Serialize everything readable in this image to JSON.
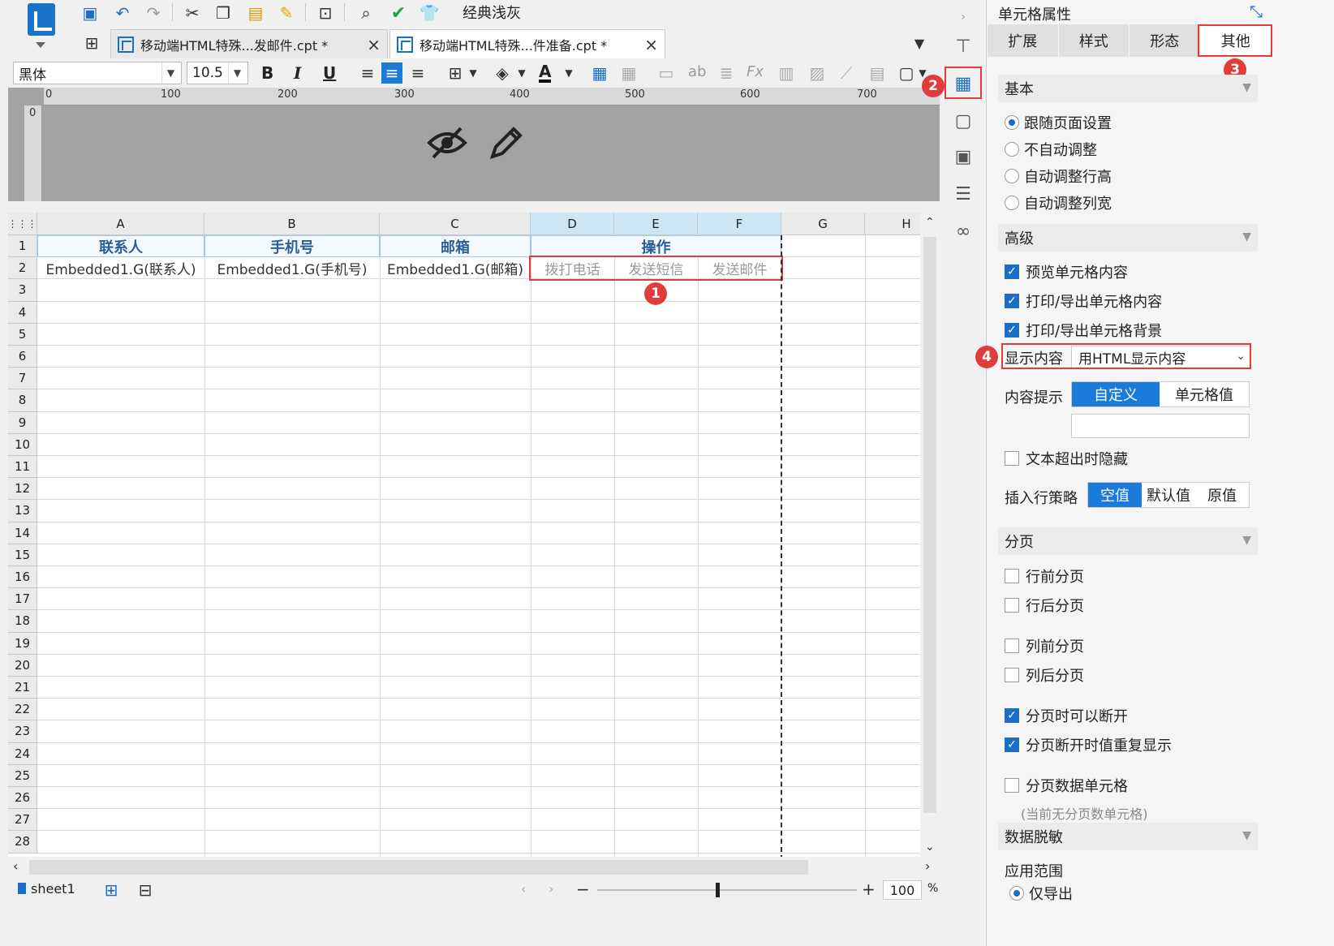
{
  "toolbar": {
    "theme_label": "经典浅灰"
  },
  "tabs": [
    {
      "label": "移动端HTML特殊...发邮件.cpt *",
      "close": "×"
    },
    {
      "label": "移动端HTML特殊...件准备.cpt *",
      "close": "×"
    }
  ],
  "format_bar": {
    "font_family": "黑体",
    "font_size": "10.5",
    "bold": "B",
    "italic": "I",
    "underline": "U",
    "font_color_label": "A"
  },
  "ruler": {
    "marks": [
      "0",
      "100",
      "200",
      "300",
      "400",
      "500",
      "600",
      "700"
    ],
    "v_zero": "0"
  },
  "sheet": {
    "columns": [
      "A",
      "B",
      "C",
      "D",
      "E",
      "F",
      "G",
      "H"
    ],
    "rows": [
      "1",
      "2",
      "3",
      "4",
      "5",
      "6",
      "7",
      "8",
      "9",
      "10",
      "11",
      "12",
      "13",
      "14",
      "15",
      "16",
      "17",
      "18",
      "19",
      "20",
      "21",
      "22",
      "23",
      "24",
      "25",
      "26",
      "27",
      "28"
    ],
    "header_row": {
      "a": "联系人",
      "b": "手机号",
      "c": "邮箱",
      "def": "操作"
    },
    "data_row": {
      "a": "Embedded1.G(联系人)",
      "b": "Embedded1.G(手机号)",
      "c": "Embedded1.G(邮箱)",
      "d": "拨打电话",
      "e": "发送短信",
      "f": "发送邮件"
    }
  },
  "badges": [
    "1",
    "2",
    "3",
    "4"
  ],
  "status": {
    "sheet_name": "sheet1",
    "zoom": "100",
    "zoom_unit": "%",
    "minus": "−",
    "plus": "+"
  },
  "panel": {
    "title": "单元格属性",
    "tabs": [
      "扩展",
      "样式",
      "形态",
      "其他"
    ],
    "basic": {
      "title": "基本",
      "options": [
        "跟随页面设置",
        "不自动调整",
        "自动调整行高",
        "自动调整列宽"
      ]
    },
    "advanced": {
      "title": "高级",
      "checks": [
        "预览单元格内容",
        "打印/导出单元格内容",
        "打印/导出单元格背景"
      ],
      "display_label": "显示内容",
      "display_value": "用HTML显示内容",
      "tip_label": "内容提示",
      "tip_options": [
        "自定义",
        "单元格值"
      ],
      "text_hide": "文本超出时隐藏",
      "insert_label": "插入行策略",
      "insert_options": [
        "空值",
        "默认值",
        "原值"
      ]
    },
    "paging": {
      "title": "分页",
      "checks": [
        "行前分页",
        "行后分页",
        "列前分页",
        "列后分页",
        "分页时可以断开",
        "分页断开时值重复显示",
        "分页数据单元格"
      ],
      "note": "(当前无分页数单元格)"
    },
    "mask": {
      "title": "数据脱敏",
      "scope_label": "应用范围",
      "scope_option": "仅导出"
    }
  },
  "colors": {
    "accent": "#1a7bd8",
    "highlight": "#e23b3b",
    "header_text": "#2b5e98"
  }
}
